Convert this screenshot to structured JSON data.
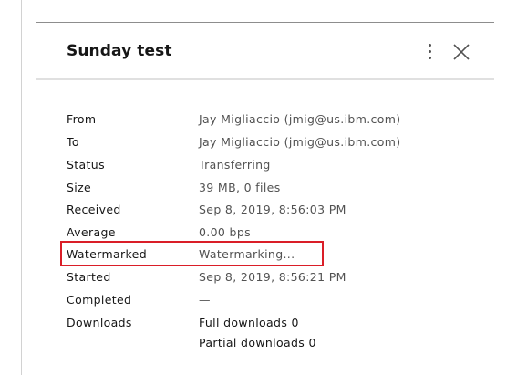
{
  "panel": {
    "title": "Sunday test",
    "menu_icon": "overflow-menu-vertical-icon",
    "close_icon": "close-icon"
  },
  "details": [
    {
      "label": "From",
      "value": "Jay Migliaccio (jmig@us.ibm.com)"
    },
    {
      "label": "To",
      "value": "Jay Migliaccio (jmig@us.ibm.com)"
    },
    {
      "label": "Status",
      "value": "Transferring"
    },
    {
      "label": "Size",
      "value": "39 MB, 0 files"
    },
    {
      "label": "Received",
      "value": "Sep 8, 2019, 8:56:03 PM"
    },
    {
      "label": "Average",
      "value": "0.00 bps"
    },
    {
      "label": "Watermarked",
      "value": "Watermarking..."
    },
    {
      "label": "Started",
      "value": "Sep 8, 2019, 8:56:21 PM"
    },
    {
      "label": "Completed",
      "value": "—"
    }
  ],
  "downloads": {
    "label": "Downloads",
    "full": "Full downloads 0",
    "partial": "Partial downloads 0"
  },
  "highlight_color": "#da1e28"
}
